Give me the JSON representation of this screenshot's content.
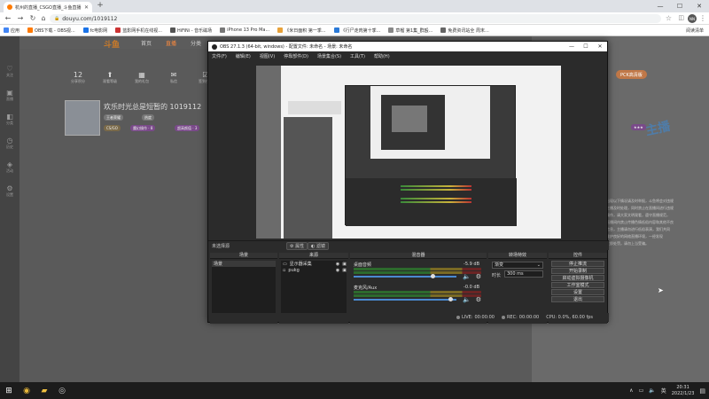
{
  "browser": {
    "tab_title": "杭州的直播_CSGO直播_斗鱼直播",
    "url": "douyu.com/1019112",
    "account_initials": "NN",
    "bookmarks": [
      "应用",
      "OBS下载 - OBS视...",
      "fc电影网",
      "蓝影网手机在线视...",
      "HiFiNi - 音乐磁场",
      "iPhone 13 Pro Ma...",
      "《米日面积 第一季...",
      "《行尸走肉第十季...",
      "草榴 第1集_群殴...",
      "免费资讯站全 周末..."
    ],
    "reading_list": "阅读清单"
  },
  "douyu": {
    "nav": [
      "首页",
      "直播",
      "分类"
    ],
    "left_nav": [
      {
        "icon": "♡",
        "label": "关注"
      },
      {
        "icon": "▣",
        "label": "直播"
      },
      {
        "icon": "◧",
        "label": "分类"
      },
      {
        "icon": "◷",
        "label": "历史"
      },
      {
        "icon": "◈",
        "label": "活动"
      },
      {
        "icon": "⚙",
        "label": "设置"
      }
    ],
    "stats": [
      {
        "n": "12",
        "l": "分享积分"
      },
      {
        "n": "⬆",
        "l": "观看等级"
      },
      {
        "n": "▦",
        "l": "我的礼包"
      },
      {
        "n": "✉",
        "l": "私信"
      },
      {
        "n": "☑",
        "l": "签到任务"
      }
    ],
    "room_title": "欢乐时光总是短暂的 1019112",
    "anchor_line": "王者荣耀",
    "hot": "热度",
    "tags": [
      "CS/GO",
      "魔幻操作 · 8",
      "超高颜值 · 3"
    ],
    "prize_button": "PCK高清版",
    "right_text": [
      "出现以下情况请及时举报，斗鱼将会对违规",
      "主播及时处理，同时禁止在直播间进行违规",
      "操作，请大家文明观看，遵守直播规范，",
      "直播间内禁止传播色情低俗内容和其他不良",
      "信息，主播请勿进行低俗表演，我们共同",
      "维护良好的网络直播环境，一经发现",
      "立即处罚，请勿上当受骗。"
    ],
    "logo": "斗鱼"
  },
  "obs": {
    "title": "OBS 27.1.3 (64-bit, windows) - 配置文件: 未命名 - 场景: 未命名",
    "menu": [
      "文件(F)",
      "编辑(E)",
      "视图(V)",
      "停靠部件(D)",
      "场景集合(S)",
      "工具(T)",
      "帮助(H)"
    ],
    "no_source": "未选择源",
    "props_btn": "属性",
    "filters_btn": "滤镜",
    "scenes": {
      "header": "场景",
      "items": [
        "场景"
      ]
    },
    "sources": {
      "header": "来源",
      "items": [
        "显示器采集",
        "pukg"
      ]
    },
    "mixer": {
      "header": "混音器",
      "channels": [
        {
          "name": "桌面音频",
          "db": "-5.9 dB",
          "level": 0.75
        },
        {
          "name": "麦克风/Aux",
          "db": "-0.0 dB",
          "level": 0.92
        }
      ]
    },
    "transitions": {
      "header": "转场特效",
      "type": "渐变",
      "duration_label": "时长",
      "duration": "300 ms"
    },
    "controls": {
      "header": "控件",
      "buttons": [
        "停止推流",
        "开始录制",
        "启动虚拟摄像机",
        "工作室模式",
        "设置",
        "退出"
      ]
    },
    "status": {
      "live_label": "LIVE:",
      "live_time": "00:00:00",
      "rec_label": "REC:",
      "rec_time": "00:00:00",
      "cpu": "CPU: 0.0%, 60.00 fps"
    }
  },
  "taskbar": {
    "time": "20:31",
    "date": "2022/1/23",
    "lang": "英"
  }
}
